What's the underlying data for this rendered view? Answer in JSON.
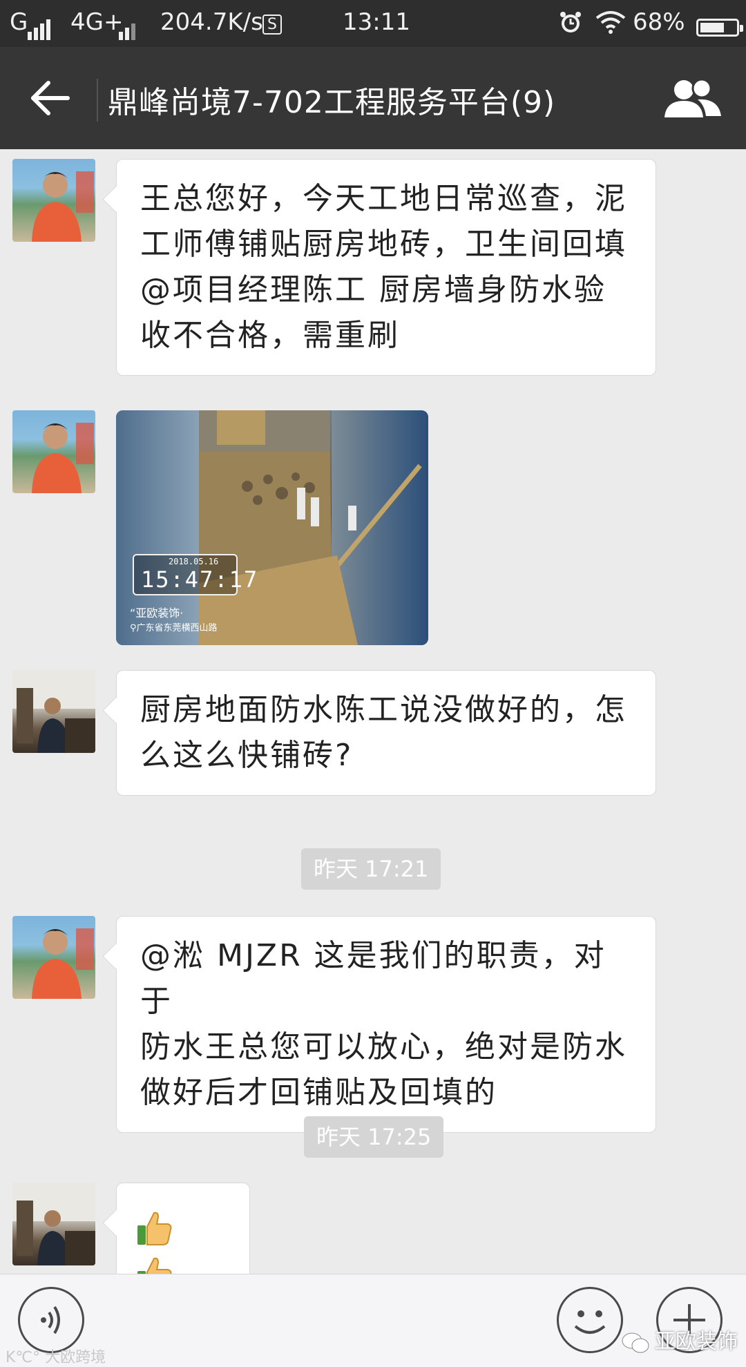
{
  "status_bar": {
    "carrier": "G",
    "network": "4G+",
    "speed": "204.7K/s",
    "s_badge": "S",
    "time": "13:11",
    "battery": "68%",
    "battery_level": 0.68
  },
  "header": {
    "title": "鼎峰尚境7-702工程服务平台(9)",
    "back_icon": "arrow-left-icon",
    "members_icon": "group-members-icon"
  },
  "messages": [
    {
      "type": "text",
      "avatar": "avatar-project-manager",
      "text": "王总您好，今天工地日常巡查，泥工师傅铺贴厨房地砖，卫生间回填@项目经理陈工  厨房墙身防水验收不合格，需重刷",
      "lines": [
        "王总您好，今天工地日常巡查，泥",
        "工师傅铺贴厨房地砖，卫生间回填",
        "@项目经理陈工  厨房墙身防水验",
        "收不合格，需重刷"
      ]
    },
    {
      "type": "image",
      "avatar": "avatar-project-manager",
      "stamp_date": "2018.05.16",
      "stamp_time": "15:47:17",
      "caption": "“亚欧装饰·",
      "location": "广东省东莞横西山路"
    },
    {
      "type": "text",
      "avatar": "avatar-homeowner",
      "lines": [
        "厨房地面防水陈工说没做好的，怎",
        "么这么快铺砖?"
      ]
    },
    {
      "type": "time",
      "text": "昨天 17:21"
    },
    {
      "type": "text",
      "avatar": "avatar-project-manager",
      "lines": [
        "@淞 MJZR  这是我们的职责，对于",
        "防水王总您可以放心，绝对是防水",
        "做好后才回铺贴及回填的"
      ]
    },
    {
      "type": "time",
      "text": "昨天 17:25"
    },
    {
      "type": "emoji",
      "avatar": "avatar-homeowner",
      "icons": [
        "thumbs-up-icon",
        "thumbs-up-icon"
      ]
    }
  ],
  "input_bar": {
    "voice_icon": "voice-icon",
    "emoji_icon": "emoji-icon",
    "plus_icon": "plus-icon"
  },
  "watermarks": {
    "left": "K℃° 大欧跨境",
    "right": "亚欧装饰"
  },
  "colors": {
    "header_bg": "#363636",
    "chat_bg": "#ebebeb",
    "bubble_bg": "#ffffff",
    "time_tag_bg": "#d5d5d5"
  }
}
